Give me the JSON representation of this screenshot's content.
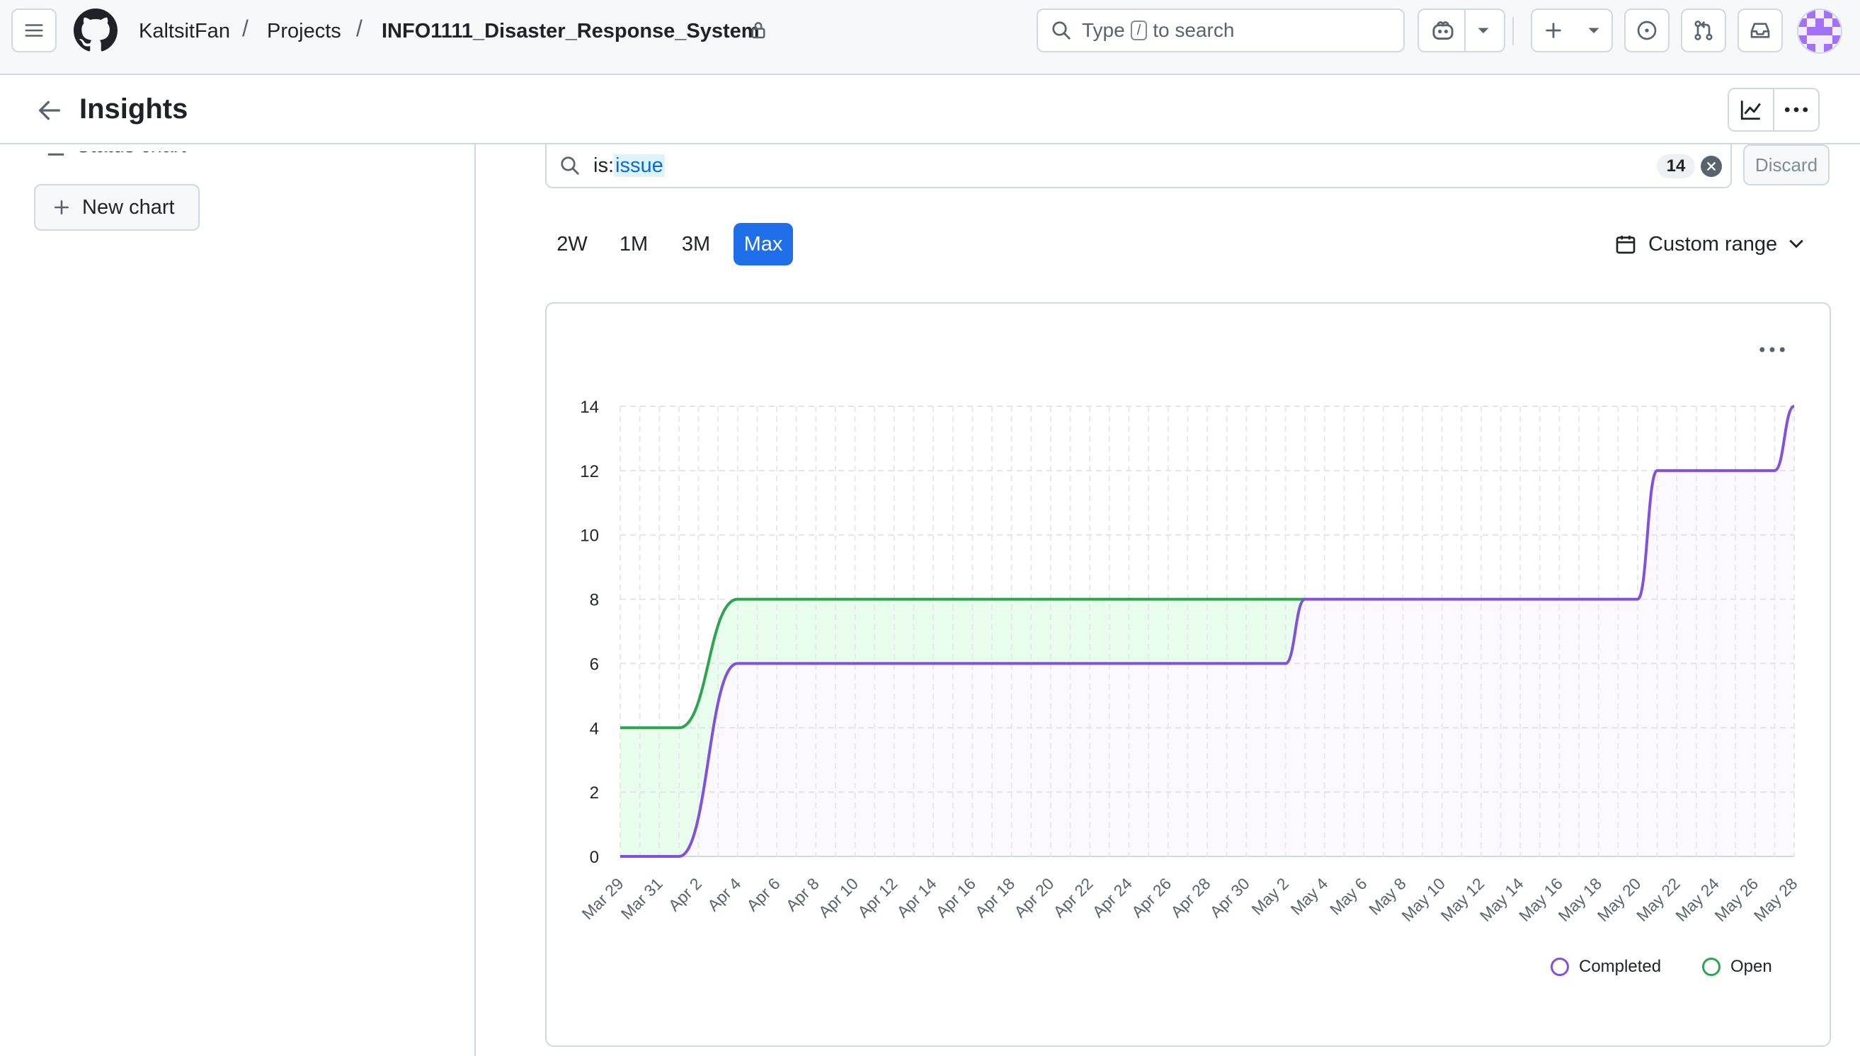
{
  "header": {
    "owner": "KaltsitFan",
    "section": "Projects",
    "repo": "INFO1111_Disaster_Response_System",
    "search_prefix": "Type",
    "search_key": "/",
    "search_suffix": "to search"
  },
  "subheader": {
    "title": "Insights"
  },
  "sidebar": {
    "status_chart_label": "Status chart",
    "new_chart_label": "New chart"
  },
  "filter": {
    "prefix": "is:",
    "value": "issue",
    "count": "14",
    "discard_label": "Discard"
  },
  "ranges": {
    "items": [
      "2W",
      "1M",
      "3M",
      "Max"
    ],
    "selected": "Max",
    "custom_label": "Custom range"
  },
  "colors": {
    "completed": "#8250df",
    "open": "#2da44e",
    "accent": "#1f6feb"
  },
  "chart_data": {
    "type": "area",
    "title": "",
    "y_ticks": [
      0,
      2,
      4,
      6,
      8,
      10,
      12,
      14
    ],
    "ylim": [
      0,
      14
    ],
    "x_tick_labels": [
      "Mar 29",
      "Mar 31",
      "Apr 2",
      "Apr 4",
      "Apr 6",
      "Apr 8",
      "Apr 10",
      "Apr 12",
      "Apr 14",
      "Apr 16",
      "Apr 18",
      "Apr 20",
      "Apr 22",
      "Apr 24",
      "Apr 26",
      "Apr 28",
      "Apr 30",
      "May 2",
      "May 4",
      "May 6",
      "May 8",
      "May 10",
      "May 12",
      "May 14",
      "May 16",
      "May 18",
      "May 20",
      "May 22",
      "May 24",
      "May 26",
      "May 28"
    ],
    "x_range": [
      "2025-03-29",
      "2025-05-28"
    ],
    "grid": true,
    "legend_position": "bottom-right",
    "series": [
      {
        "name": "Completed",
        "points": [
          {
            "x": "2025-03-29",
            "y": 0
          },
          {
            "x": "2025-04-01",
            "y": 0
          },
          {
            "x": "2025-04-04",
            "y": 6
          },
          {
            "x": "2025-05-02",
            "y": 6
          },
          {
            "x": "2025-05-03",
            "y": 8
          },
          {
            "x": "2025-05-20",
            "y": 8
          },
          {
            "x": "2025-05-21",
            "y": 12
          },
          {
            "x": "2025-05-27",
            "y": 12
          },
          {
            "x": "2025-05-28",
            "y": 14
          }
        ]
      },
      {
        "name": "Open",
        "points": [
          {
            "x": "2025-03-29",
            "y": 4
          },
          {
            "x": "2025-04-01",
            "y": 4
          },
          {
            "x": "2025-04-04",
            "y": 8
          },
          {
            "x": "2025-05-03",
            "y": 8
          }
        ]
      }
    ]
  }
}
